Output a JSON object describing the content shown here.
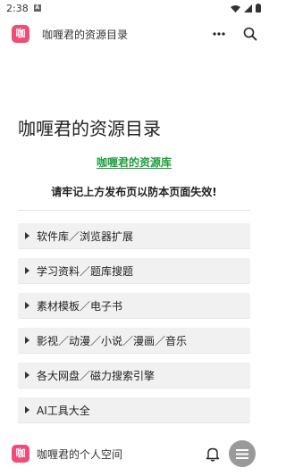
{
  "status_bar": {
    "time": "2:38",
    "alert_glyph": "A",
    "icons": [
      "wifi-icon",
      "signal-icon",
      "battery-icon"
    ]
  },
  "app_bar": {
    "logo_text": "咖",
    "title": "咖喱君的资源目录",
    "actions": [
      "more-icon",
      "search-icon"
    ]
  },
  "page": {
    "title": "咖喱君的资源目录",
    "site_link": "咖喱君的资源库",
    "notice": "请牢记上方发布页以防本页面失效!",
    "menu": [
      {
        "label": "软件库／浏览器扩展"
      },
      {
        "label": "学习资料／题库搜题"
      },
      {
        "label": "素材模板／电子书"
      },
      {
        "label": "影视／动漫／小说／漫画／音乐"
      },
      {
        "label": "各大网盘／磁力搜索引擎"
      },
      {
        "label": "AI工具大全"
      }
    ]
  },
  "bottom_bar": {
    "logo_text": "咖",
    "title": "咖喱君的个人空间",
    "icons": [
      "bell-icon",
      "menu-fab-icon"
    ]
  },
  "colors": {
    "brand": "#f24b78",
    "link": "#1e9d3c",
    "menu_bg": "#f1f1f1",
    "fab": "#9a9a9a"
  }
}
